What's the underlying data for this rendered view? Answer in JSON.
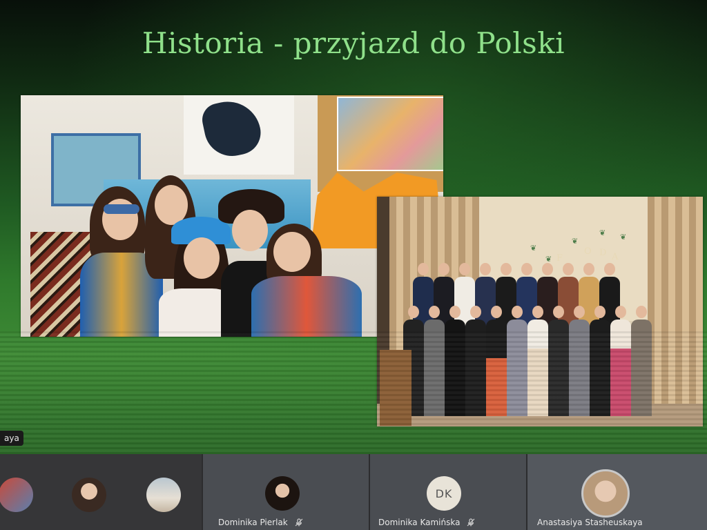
{
  "slide": {
    "title": "Historia - przyjazd do Polski"
  },
  "speaker_label": "aya",
  "participants": [
    {
      "name": "",
      "avatar": "photo-avatar"
    },
    {
      "name": "",
      "avatar": "photo-avatar"
    },
    {
      "name": "",
      "avatar": "photo-avatar"
    },
    {
      "name": "Dominika Pierlak",
      "avatar": "photo-avatar",
      "muted": true
    },
    {
      "name": "Dominika Kamińska",
      "avatar": "initials",
      "initials": "DK",
      "muted": true
    },
    {
      "name": "Anastasiya Stasheuskaya",
      "avatar": "photo-avatar"
    }
  ],
  "colors": {
    "title": "#8fe08a",
    "strip": "#2c2c2e",
    "active_ring": "#c8c8c8"
  },
  "icons": [
    "mic-off-icon"
  ]
}
